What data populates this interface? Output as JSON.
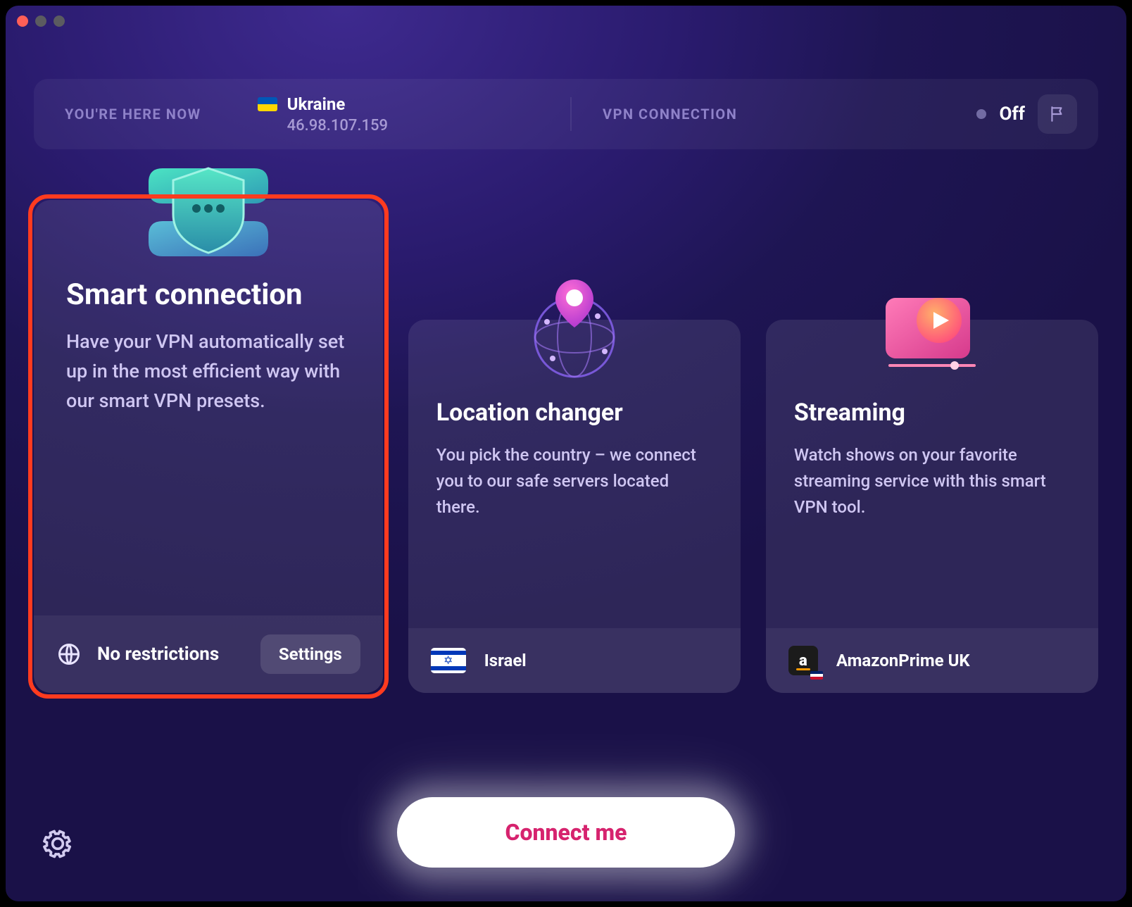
{
  "status": {
    "here_label": "YOU'RE HERE NOW",
    "country": "Ukraine",
    "ip": "46.98.107.159",
    "vpn_label": "VPN CONNECTION",
    "state": "Off"
  },
  "cards": {
    "smart": {
      "title": "Smart connection",
      "desc": "Have your VPN automatically set up in the most efficient way with our smart VPN presets.",
      "footer_label": "No restrictions",
      "settings_label": "Settings"
    },
    "location": {
      "title": "Location changer",
      "desc": "You pick the country – we connect you to our safe servers located there.",
      "footer_label": "Israel"
    },
    "streaming": {
      "title": "Streaming",
      "desc": "Watch shows on your favorite streaming service with this smart VPN tool.",
      "footer_label": "AmazonPrime UK"
    }
  },
  "connect_label": "Connect me"
}
